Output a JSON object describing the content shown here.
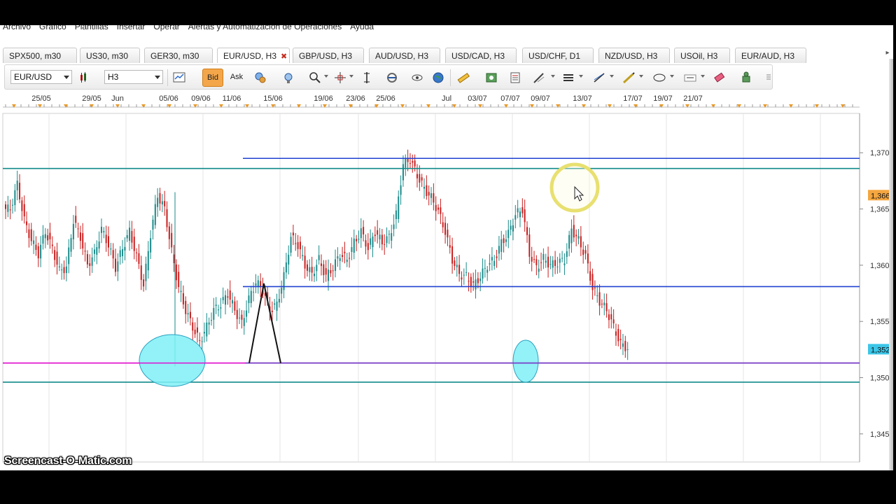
{
  "menu": [
    "Archivo",
    "Gráfico",
    "Plantillas",
    "Insertar",
    "Operar",
    "Alertas y Automatización de Operaciones",
    "Ayuda"
  ],
  "tabs": [
    {
      "label": "SPX500, m30",
      "active": false,
      "close": ""
    },
    {
      "label": "US30, m30",
      "active": false,
      "close": ""
    },
    {
      "label": "GER30, m30",
      "active": false,
      "close": ""
    },
    {
      "label": "EUR/USD, H3",
      "active": true,
      "close": "✖"
    },
    {
      "label": "GBP/USD, H3",
      "active": false,
      "close": ""
    },
    {
      "label": "AUD/USD, H3",
      "active": false,
      "close": ""
    },
    {
      "label": "USD/CAD, H3",
      "active": false,
      "close": ""
    },
    {
      "label": "USD/CHF, D1",
      "active": false,
      "close": ""
    },
    {
      "label": "NZD/USD, H3",
      "active": false,
      "close": ""
    },
    {
      "label": "USOil, H3",
      "active": false,
      "close": ""
    },
    {
      "label": "EUR/AUD, H3",
      "active": false,
      "close": ""
    }
  ],
  "toolbar": {
    "symbol": "EUR/USD",
    "timeframe": "H3",
    "bid_label": "Bid",
    "ask_label": "Ask",
    "bid_color": "#f4a64a"
  },
  "watermark": "Screencast-O-Matic.com",
  "chart_data": {
    "type": "candlestick",
    "symbol": "EUR/USD",
    "timeframe": "H3",
    "x_ticks": [
      "25/05",
      "29/05",
      "Jun",
      "05/06",
      "09/06",
      "11/06",
      "15/06",
      "19/06",
      "23/06",
      "25/06",
      "Jul",
      "03/07",
      "07/07",
      "09/07",
      "13/07",
      "17/07",
      "19/07",
      "21/07"
    ],
    "y_ticks": [
      "1,370",
      "1,365",
      "1,360",
      "1,355",
      "1,350",
      "1,345"
    ],
    "y_tick_values": [
      1.37,
      1.365,
      1.36,
      1.355,
      1.35,
      1.345
    ],
    "ylim": [
      1.3425,
      1.3735
    ],
    "price_labels": [
      {
        "text": "1,366",
        "value": 1.3662,
        "bg": "#f4a640"
      },
      {
        "text": "1,352",
        "value": 1.3525,
        "bg": "#3cc6e8"
      }
    ],
    "horizontal_lines": [
      {
        "value": 1.3695,
        "color": "#2040d0",
        "x_from": 0.0,
        "x_to": 1.0,
        "start_index": 30
      },
      {
        "value": 1.3686,
        "color": "#108a8a",
        "x_from": 0.0,
        "x_to": 1.0,
        "start_index": 0
      },
      {
        "value": 1.3581,
        "color": "#2040d0",
        "x_from": 0.0,
        "x_to": 1.0,
        "start_index": 30
      },
      {
        "value": 1.3513,
        "color": "#e010d0",
        "x_from": 0.0,
        "x_to": 0.29,
        "start_index": 0
      },
      {
        "value": 1.3513,
        "color": "#7a3fc8",
        "x_from": 0.29,
        "x_to": 1.0,
        "start_index": 30
      },
      {
        "value": 1.3496,
        "color": "#108a8a",
        "x_from": 0.0,
        "x_to": 1.0,
        "start_index": 0
      }
    ],
    "ohlc_close_path": [
      1.365,
      1.3672,
      1.364,
      1.3622,
      1.361,
      1.363,
      1.3615,
      1.3595,
      1.3598,
      1.364,
      1.3625,
      1.36,
      1.361,
      1.3632,
      1.3618,
      1.3598,
      1.3615,
      1.363,
      1.3608,
      1.3582,
      1.3628,
      1.3662,
      1.365,
      1.3612,
      1.358,
      1.356,
      1.3545,
      1.3532,
      1.3545,
      1.356,
      1.3565,
      1.3575,
      1.356,
      1.3548,
      1.357,
      1.3585,
      1.3578,
      1.356,
      1.3565,
      1.359,
      1.3625,
      1.3618,
      1.36,
      1.3592,
      1.3605,
      1.359,
      1.3598,
      1.361,
      1.3605,
      1.362,
      1.363,
      1.3615,
      1.363,
      1.362,
      1.3625,
      1.3645,
      1.369,
      1.3694,
      1.368,
      1.3668,
      1.366,
      1.3648,
      1.363,
      1.3605,
      1.3592,
      1.359,
      1.3582,
      1.359,
      1.36,
      1.3605,
      1.362,
      1.3628,
      1.3645,
      1.365,
      1.361,
      1.3598,
      1.3606,
      1.36,
      1.3602,
      1.3605,
      1.3632,
      1.3622,
      1.3608,
      1.358,
      1.3568,
      1.356,
      1.3545,
      1.353,
      1.3526
    ]
  }
}
